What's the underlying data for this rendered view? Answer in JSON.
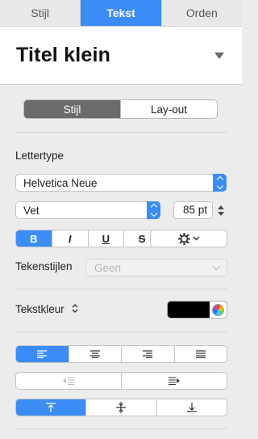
{
  "tabs": [
    {
      "label": "Stijl",
      "active": false
    },
    {
      "label": "Tekst",
      "active": true
    },
    {
      "label": "Orden",
      "active": false
    }
  ],
  "style_header": {
    "title": "Titel klein"
  },
  "mode_toggle": {
    "stijl": "Stijl",
    "layout": "Lay-out",
    "active": "Stijl"
  },
  "font": {
    "section_label": "Lettertype",
    "family": "Helvetica Neue",
    "weight": "Vet",
    "size": "85 pt"
  },
  "format_buttons": {
    "bold": "B",
    "italic": "I",
    "underline": "U",
    "strikethrough": "S",
    "active": "bold"
  },
  "character_styles": {
    "label": "Tekenstijlen",
    "value": "Geen"
  },
  "text_color": {
    "label": "Tekstkleur",
    "color": "#000000"
  },
  "alignment": {
    "active": "left"
  },
  "vertical_alignment": {
    "active": "top"
  },
  "colors": {
    "accent": "#3b8cf5"
  }
}
